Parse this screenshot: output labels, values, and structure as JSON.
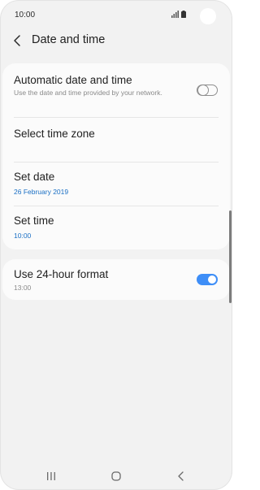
{
  "status_bar": {
    "time": "10:00"
  },
  "header": {
    "title": "Date and time",
    "back_icon": "chevron-left-icon"
  },
  "settings": {
    "automatic": {
      "title": "Automatic date and time",
      "description": "Use the date and time provided by your network.",
      "enabled": false
    },
    "time_zone": {
      "title": "Select time zone"
    },
    "set_date": {
      "title": "Set date",
      "value": "26 February 2019"
    },
    "set_time": {
      "title": "Set time",
      "value": "10:00"
    },
    "format_24h": {
      "title": "Use 24-hour format",
      "value": "13:00",
      "enabled": true
    }
  },
  "nav_bar": {
    "items": [
      "recents-icon",
      "home-icon",
      "back-icon"
    ]
  },
  "colors": {
    "accent": "#3e8ef7",
    "link_text": "#1a6fc4",
    "background": "#f2f2f2",
    "card": "#fbfbfb"
  }
}
